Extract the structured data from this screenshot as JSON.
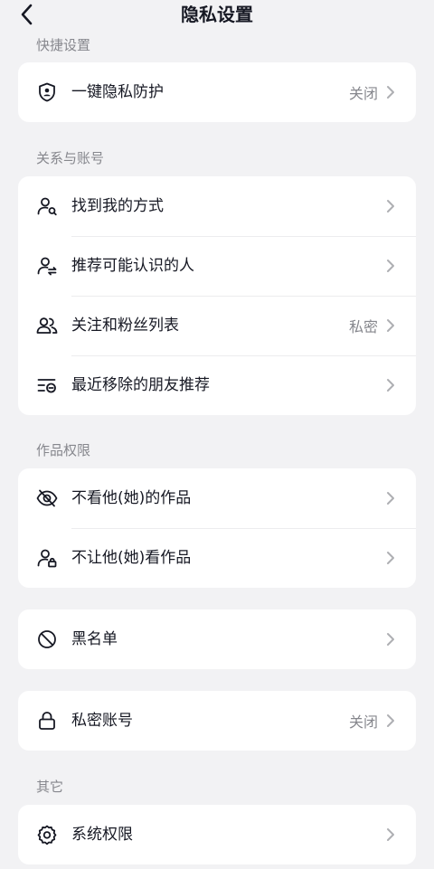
{
  "header": {
    "title": "隐私设置"
  },
  "sections": {
    "quick": "快捷设置",
    "relations": "关系与账号",
    "works": "作品权限",
    "other": "其它"
  },
  "cards": [
    {
      "items": [
        {
          "label": "一键隐私防护",
          "value": "关闭",
          "icon": "shield-person-icon"
        }
      ]
    },
    {
      "items": [
        {
          "label": "找到我的方式",
          "value": "",
          "icon": "person-search-icon"
        },
        {
          "label": "推荐可能认识的人",
          "value": "",
          "icon": "person-swap-icon"
        },
        {
          "label": "关注和粉丝列表",
          "value": "私密",
          "icon": "people-icon"
        },
        {
          "label": "最近移除的朋友推荐",
          "value": "",
          "icon": "list-remove-icon"
        }
      ]
    },
    {
      "items": [
        {
          "label": "不看他(她)的作品",
          "value": "",
          "icon": "eye-off-icon"
        },
        {
          "label": "不让他(她)看作品",
          "value": "",
          "icon": "person-lock-icon"
        }
      ]
    },
    {
      "items": [
        {
          "label": "黑名单",
          "value": "",
          "icon": "block-icon"
        }
      ]
    },
    {
      "items": [
        {
          "label": "私密账号",
          "value": "关闭",
          "icon": "lock-icon"
        }
      ]
    },
    {
      "items": [
        {
          "label": "系统权限",
          "value": "",
          "icon": "gear-icon"
        }
      ]
    }
  ]
}
